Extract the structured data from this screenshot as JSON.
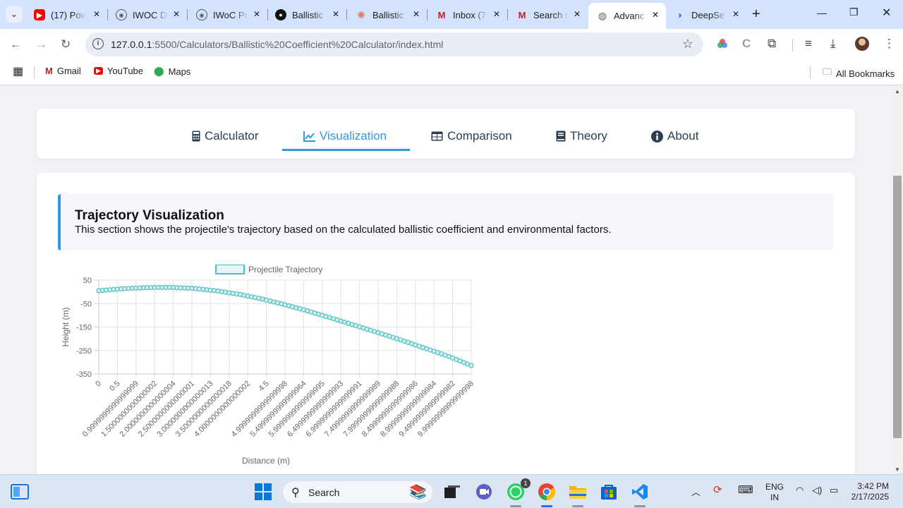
{
  "browser": {
    "tabs": [
      {
        "title": "(17) Pow",
        "favicon": "youtube-icon",
        "color": "#ff0000"
      },
      {
        "title": "IWOC D",
        "favicon": "github-octocat-icon",
        "color": "#555555"
      },
      {
        "title": "IWoC Pr",
        "favicon": "github-octocat-icon",
        "color": "#555555"
      },
      {
        "title": "Ballistic",
        "favicon": "github-icon",
        "color": "#111111"
      },
      {
        "title": "Ballistic",
        "favicon": "sun-icon",
        "color": "#e07a5f"
      },
      {
        "title": "Inbox (7",
        "favicon": "gmail-icon",
        "color": "#c5221f"
      },
      {
        "title": "Search r",
        "favicon": "gmail-icon",
        "color": "#c5221f"
      },
      {
        "title": "Advanc",
        "favicon": "globe-icon",
        "color": "#5f6368"
      },
      {
        "title": "DeepSe",
        "favicon": "deepseek-icon",
        "color": "#4d6bfe"
      }
    ],
    "url_host": "127.0.0.1",
    "url_path": ":5500/Calculators/Ballistic%20Coefficient%20Calculator/index.html",
    "bookmarks": [
      {
        "label": "Gmail",
        "icon": "gmail-icon"
      },
      {
        "label": "YouTube",
        "icon": "youtube-icon"
      },
      {
        "label": "Maps",
        "icon": "maps-icon"
      }
    ],
    "all_bookmarks": "All Bookmarks"
  },
  "nav": {
    "tabs": [
      {
        "label": "Calculator",
        "icon": "calculator-icon",
        "active": false
      },
      {
        "label": "Visualization",
        "icon": "line-chart-icon",
        "active": true
      },
      {
        "label": "Comparison",
        "icon": "table-icon",
        "active": false
      },
      {
        "label": "Theory",
        "icon": "book-icon",
        "active": false
      },
      {
        "label": "About",
        "icon": "info-icon",
        "active": false
      }
    ],
    "accent": "#3498db"
  },
  "section": {
    "title": "Trajectory Visualization",
    "description": "This section shows the projectile's trajectory based on the calculated ballistic coefficient and environmental factors."
  },
  "chart_data": {
    "type": "line",
    "xlabel": "Distance (m)",
    "ylabel": "Height (m)",
    "legend": "top",
    "series": [
      {
        "name": "Projectile Trajectory",
        "color": "#4bc0c0"
      }
    ],
    "y_ticks": [
      "50",
      "-50",
      "-150",
      "-250",
      "-350"
    ],
    "ylim": [
      -350,
      50
    ],
    "x_tick_labels": [
      "0",
      "0.5",
      "0.9999999999999999",
      "1.5000000000000002",
      "2.0000000000000004",
      "2.5000000000000001",
      "3.0000000000000013",
      "3.5000000000000018",
      "4.0000000000000002",
      "4.5",
      "4.9999999999999998",
      "5.4999999999999964",
      "5.9999999999999995",
      "6.4999999999999993",
      "6.9999999999999991",
      "7.4999999999999989",
      "7.9999999999999988",
      "8.4999999999999986",
      "8.9999999999999984",
      "9.4999999999999982",
      "9.9999999999999998"
    ],
    "x": [
      0,
      0.5,
      1.0,
      1.5,
      2.0,
      2.5,
      3.0,
      3.5,
      4.0,
      4.5,
      5.0,
      5.5,
      6.0,
      6.5,
      7.0,
      7.5,
      8.0,
      8.5,
      9.0,
      9.5,
      10.0
    ],
    "y": [
      5,
      13,
      18,
      19,
      15,
      5,
      -10,
      -30,
      -55,
      -82,
      -112,
      -143,
      -174,
      -206,
      -240,
      -274,
      -314
    ]
  },
  "taskbar": {
    "search_label": "Search",
    "lang_top": "ENG",
    "lang_bottom": "IN",
    "time": "3:42 PM",
    "date": "2/17/2025",
    "whatsapp_badge": "1"
  }
}
